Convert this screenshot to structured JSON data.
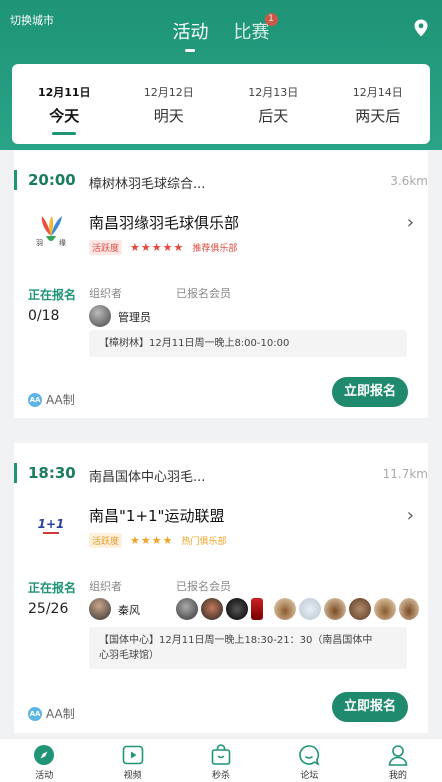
{
  "header": {
    "switch_city": "切换城市",
    "tabs": [
      {
        "label": "活动"
      },
      {
        "label": "比赛",
        "badge": "1"
      }
    ],
    "accent_color": "#1f9477"
  },
  "dates": [
    {
      "date": "12月11日",
      "day": "今天"
    },
    {
      "date": "12月12日",
      "day": "明天"
    },
    {
      "date": "12月13日",
      "day": "后天"
    },
    {
      "date": "12月14日",
      "day": "两天后"
    }
  ],
  "activities": [
    {
      "time": "20:00",
      "venue": "樟树林羽毛球综合...",
      "distance": "3.6km",
      "club_name": "南昌羽缘羽毛球俱乐部",
      "logo_text": "羽 缘",
      "activity_tag": "活跃度",
      "stars": "★★★★★",
      "recommend": "推荐俱乐部",
      "status": "正在报名",
      "count": "0/18",
      "organizer_label": "组织者",
      "organizer": "管理员",
      "members_label": "已报名会员",
      "note": "【樟树林】12月11日周一晚上8:00-10:00",
      "aa": "AA制",
      "aa_icon": "AA",
      "signup": "立即报名"
    },
    {
      "time": "18:30",
      "venue": "南昌国体中心羽毛...",
      "distance": "11.7km",
      "club_name": "南昌\"1+1\"运动联盟",
      "logo_text": "1+1",
      "activity_tag": "活跃度",
      "stars": "★★★★",
      "recommend": "热门俱乐部",
      "status": "正在报名",
      "count": "25/26",
      "organizer_label": "组织者",
      "organizer": "秦风",
      "members_label": "已报名会员",
      "note_line1": "【国体中心】12月11日周一晚上18:30-21：30（南昌国体中",
      "note_line2": "心羽毛球馆）",
      "aa": "AA制",
      "aa_icon": "AA",
      "signup": "立即报名"
    }
  ],
  "tabbar": [
    {
      "label": "活动",
      "icon": "compass-icon"
    },
    {
      "label": "视频",
      "icon": "play-icon"
    },
    {
      "label": "秒杀",
      "icon": "bag-icon"
    },
    {
      "label": "论坛",
      "icon": "chat-icon"
    },
    {
      "label": "我的",
      "icon": "user-icon"
    }
  ]
}
